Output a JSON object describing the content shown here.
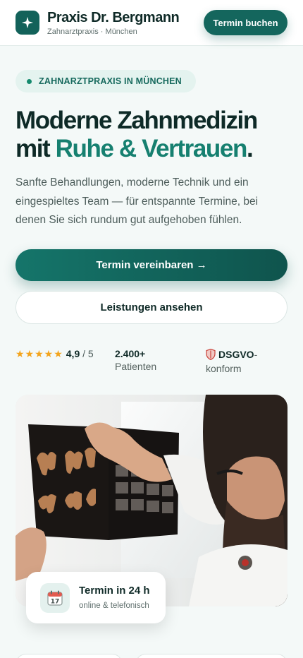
{
  "header": {
    "logo_icon": "sparkle-icon",
    "title": "Praxis Dr. Bergmann",
    "subtitle": "Zahnarztpraxis · München",
    "cta_label": "Termin buchen"
  },
  "hero": {
    "badge": "ZAHNARZTPRAXIS IN MÜNCHEN",
    "headline_line1": "Moderne Zahnmedizin",
    "headline_mit": "mit",
    "headline_accent": "Ruhe & Vertrauen",
    "headline_end": ".",
    "lead": "Sanfte Behandlungen, moderne Technik und ein eingespieltes Team — für entspannte Termine, bei denen Sie sich rundum gut aufgehoben fühlen.",
    "primary_cta": "Termin vereinbaren →",
    "secondary_cta": "Leistungen ansehen"
  },
  "trust": {
    "stars": "★★★★★",
    "rating": "4,9",
    "rating_suffix": " / 5",
    "patients_value": "2.400+",
    "patients_label": "Patienten",
    "dsgvo_strong": "DSGVO",
    "dsgvo_rest": "-konform"
  },
  "card": {
    "icon": "calendar-icon",
    "calendar_day": "17",
    "title": "Termin in 24 h",
    "subtitle": "online & telefonisch"
  },
  "colors": {
    "brand": "#13625a",
    "accent": "#168070",
    "star": "#f3a41c"
  }
}
